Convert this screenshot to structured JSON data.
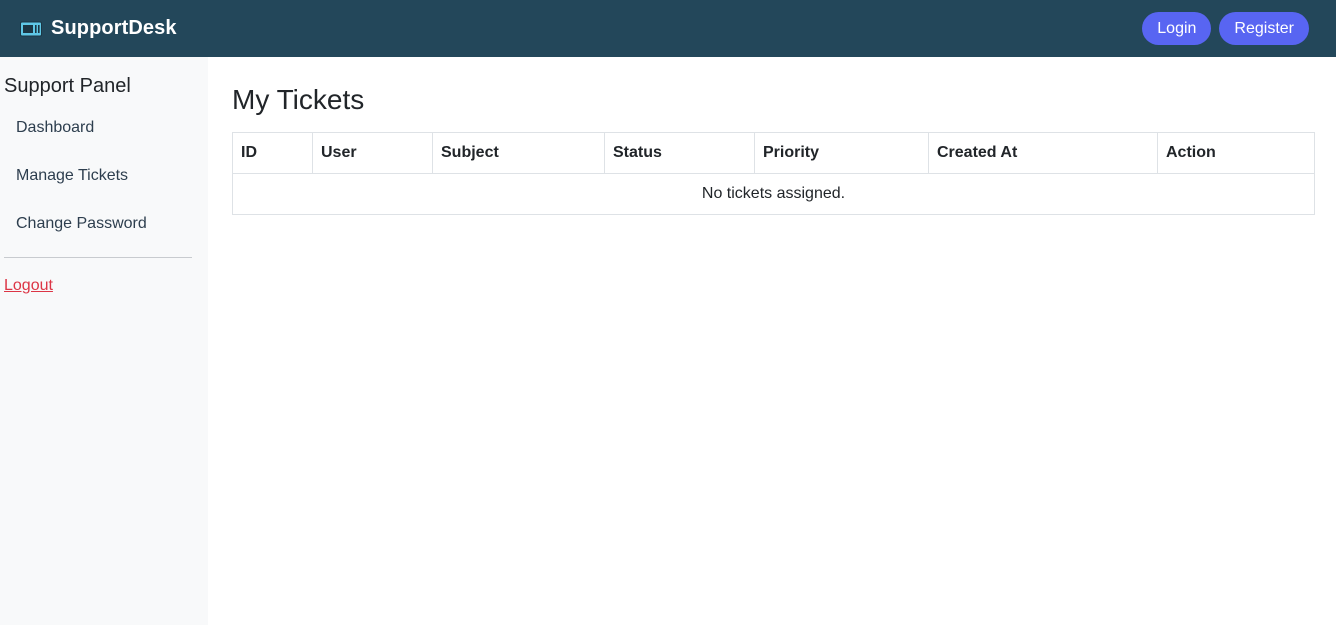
{
  "header": {
    "brand_name": "SupportDesk",
    "brand_icon": "ticket-icon",
    "login_label": "Login",
    "register_label": "Register",
    "colors": {
      "background": "#23475a",
      "button": "#5865f2"
    }
  },
  "sidebar": {
    "title": "Support Panel",
    "items": [
      {
        "label": "Dashboard"
      },
      {
        "label": "Manage Tickets"
      },
      {
        "label": "Change Password"
      }
    ],
    "logout_label": "Logout",
    "colors": {
      "logout": "#dc3545"
    }
  },
  "main": {
    "title": "My Tickets",
    "table": {
      "columns": [
        "ID",
        "User",
        "Subject",
        "Status",
        "Priority",
        "Created At",
        "Action"
      ],
      "empty_message": "No tickets assigned."
    }
  }
}
